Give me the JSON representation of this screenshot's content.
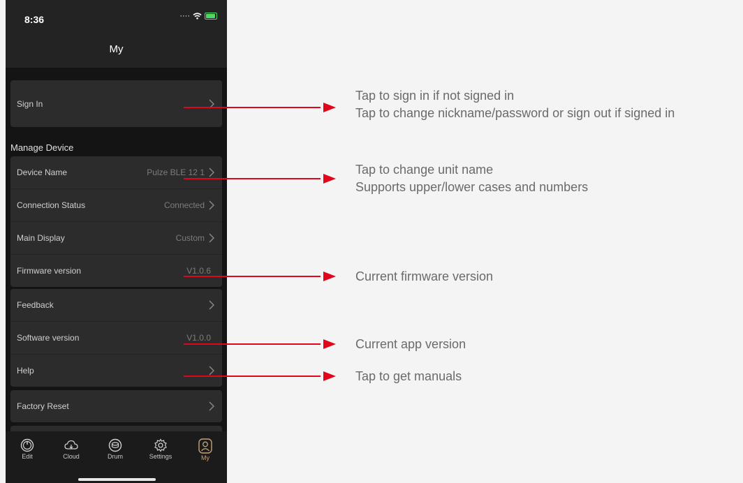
{
  "status_bar": {
    "time": "8:36"
  },
  "header": {
    "title": "My"
  },
  "account": {
    "sign_in_label": "Sign In"
  },
  "manage_device": {
    "section_title": "Manage Device",
    "device_name_label": "Device Name",
    "device_name_value": "Pulze BLE 12 1",
    "connection_label": "Connection Status",
    "connection_value": "Connected",
    "main_display_label": "Main Display",
    "main_display_value": "Custom",
    "firmware_label": "Firmware version",
    "firmware_value": "V1.0.6"
  },
  "support": {
    "feedback_label": "Feedback",
    "software_label": "Software version",
    "software_value": "V1.0.0",
    "help_label": "Help"
  },
  "reset": {
    "factory_reset_label": "Factory Reset"
  },
  "tabbar": {
    "edit": "Edit",
    "cloud": "Cloud",
    "drum": "Drum",
    "settings": "Settings",
    "my": "My",
    "active_color": "#c7a078"
  },
  "annotations": {
    "sign_in_line1": "Tap to sign in if not signed in",
    "sign_in_line2": "Tap to change nickname/password or sign out if signed in",
    "device_name_line1": "Tap to change unit name",
    "device_name_line2": "Supports upper/lower cases and numbers",
    "firmware": "Current firmware version",
    "app_version": "Current app version",
    "manuals": "Tap to get manuals",
    "arrow_color": "#e1061b"
  }
}
